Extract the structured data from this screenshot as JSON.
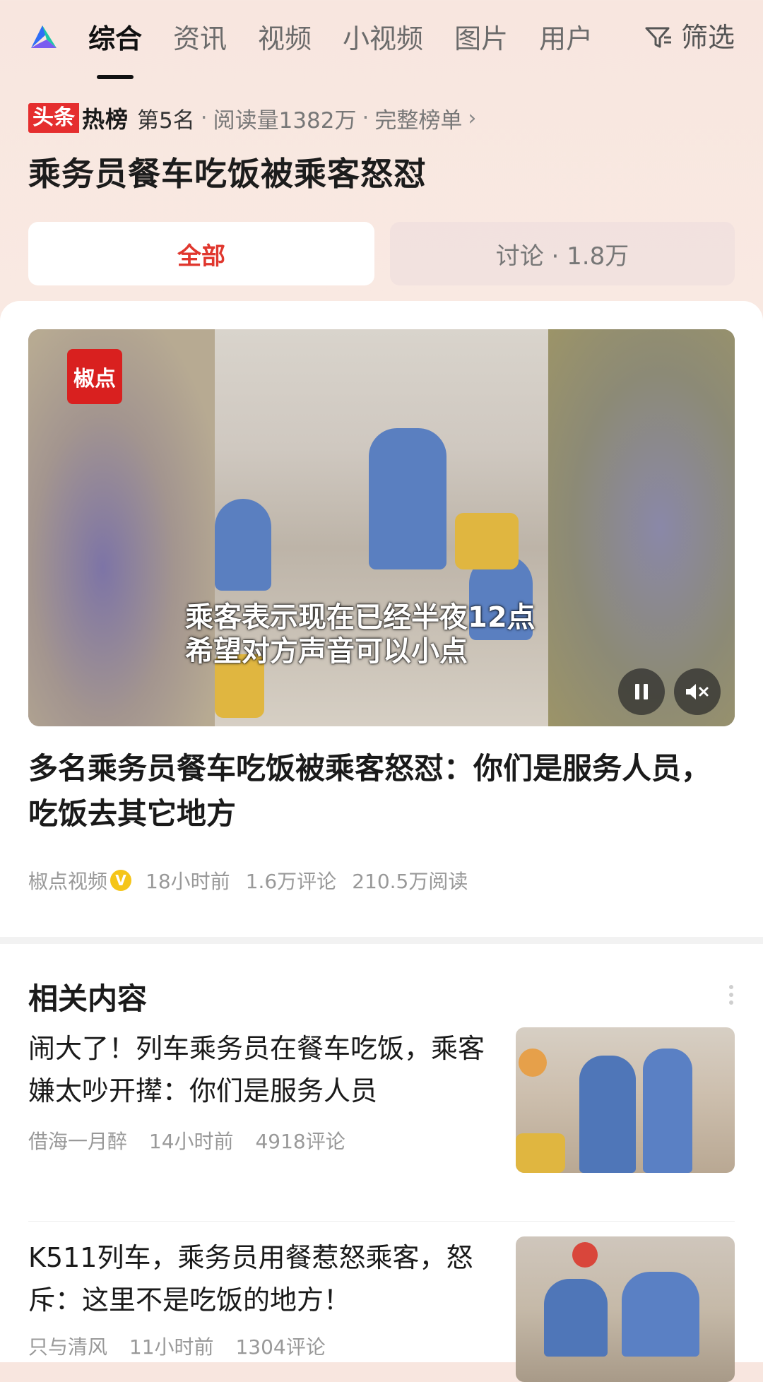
{
  "tabs": [
    "综合",
    "资讯",
    "视频",
    "小视频",
    "图片",
    "用户"
  ],
  "filter_label": "筛选",
  "hot": {
    "brand_a": "头条",
    "brand_b": "热榜",
    "rank": "第5名",
    "reads": "阅读量1382万",
    "full_list": "完整榜单"
  },
  "headline": "乘务员餐车吃饭被乘客怒怼",
  "segments": {
    "all": "全部",
    "discuss": "讨论 · 1.8万"
  },
  "video": {
    "logo_text": "椒点",
    "subtitle_line1": "乘客表示现在已经半夜12点",
    "subtitle_line2": "希望对方声音可以小点"
  },
  "article": {
    "title": "多名乘务员餐车吃饭被乘客怒怼：你们是服务人员，吃饭去其它地方",
    "source": "椒点视频",
    "time": "18小时前",
    "comments": "1.6万评论",
    "reads": "210.5万阅读"
  },
  "related": {
    "title": "相关内容",
    "items": [
      {
        "text": "闹大了！列车乘务员在餐车吃饭，乘客嫌太吵开撵：你们是服务人员",
        "author": "借海一月醉",
        "time": "14小时前",
        "comments": "4918评论"
      },
      {
        "text": "K511列车，乘务员用餐惹怒乘客，怒斥：这里不是吃饭的地方！",
        "author": "只与清风",
        "time": "11小时前",
        "comments": "1304评论"
      }
    ]
  },
  "colors": {
    "accent_red": "#e0372e",
    "brand_red": "#e52e2e",
    "verified_yellow": "#f5c518"
  }
}
